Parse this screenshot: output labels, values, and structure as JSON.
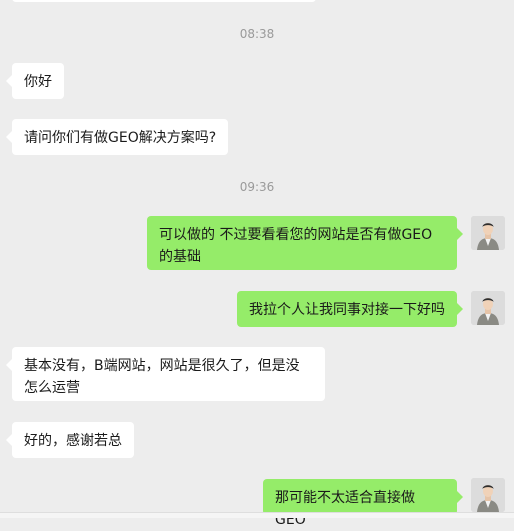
{
  "timestamps": [
    "08:38",
    "09:36"
  ],
  "messages": [
    {
      "side": "in",
      "text": "你好"
    },
    {
      "side": "in",
      "text": "请问你们有做GEO解决方案吗?"
    },
    {
      "side": "out",
      "text": "可以做的 不过要看看您的网站是否有做GEO的基础"
    },
    {
      "side": "out",
      "text": "我拉个人让我同事对接一下好吗"
    },
    {
      "side": "in",
      "text": "基本没有，B端网站，网站是很久了，但是没怎么运营"
    },
    {
      "side": "in",
      "text": "好的，感谢若总"
    },
    {
      "side": "out",
      "text": "那可能不太适合直接做GEO"
    }
  ],
  "avatar_icon": "user-avatar-man-in-suit",
  "colors": {
    "background": "#ededed",
    "incoming": "#ffffff",
    "outgoing": "#95ec69",
    "timestamp": "#9a9a9a"
  }
}
